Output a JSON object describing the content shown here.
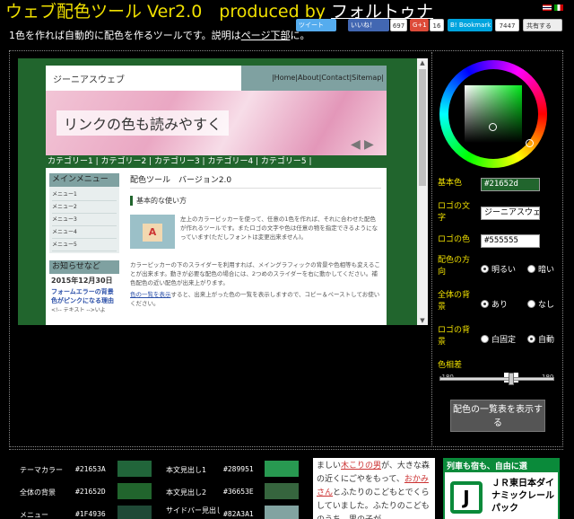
{
  "header": {
    "title": "ウェブ配色ツール Ver2.0　produced by ",
    "author": "フォルトゥナ",
    "subtitle_pre": "1色を作れば自動的に配色を作るツールです。説明は",
    "subtitle_link": "ページ下部",
    "subtitle_post": "に。"
  },
  "social": {
    "tweet": "ツイート",
    "like": "いいね！",
    "like_count": "697",
    "gplus": "G+1",
    "gplus_count": "16",
    "bookmark": "B! Bookmark",
    "bookmark_count": "7447",
    "share": "共有する"
  },
  "preview": {
    "site_name": "ジーニアスウェブ",
    "nav": "|Home|About|Contact|Sitemap|",
    "hero_text": "リンクの色も読みやすく",
    "categories": "カテゴリー1 | カテゴリー2 | カテゴリー3 | カテゴリー4 | カテゴリー5 |",
    "main_menu_title": "メインメニュー",
    "menu_items": [
      "メニュー1",
      "メニュー2",
      "メニュー3",
      "メニュー4",
      "メニュー5"
    ],
    "news_title": "お知らせなど",
    "news_date": "2015年12月30日",
    "news_link": "フォームエラーの背景色がピンクになる理由",
    "news_note": "<!-- テキスト -->いよ",
    "article_title": "配色ツール　バージョン2.0",
    "article_subtitle": "基本的な使い方",
    "article_p1": "左上のカラーピッカーを使って、任意の1色を作れば、それに合わせた配色が作れるツールです。またロゴの文字や色は任意の物を指定できるようになっています(ただしフォントは変更出来ません)。",
    "article_p2": "カラーピッカーの下のスライダーを利用すれば、メイングラフィックの背景や色相等も変えることが出来ます。動きが必要な配色の場合には、2つめのスライダーを右に動かしてください。補色配色の近い配色が出来上がります。",
    "article_p3_link": "色の一覧を表示",
    "article_p3": "すると、出来上がった色の一覧を表示しますので、コピー＆ペーストしてお使いください。"
  },
  "controls": {
    "base_color_label": "基本色",
    "base_color_value": "#21652d",
    "logo_text_label": "ロゴの文字",
    "logo_text_value": "ジーニアスウェブ",
    "logo_color_label": "ロゴの色",
    "logo_color_value": "#555555",
    "direction_label": "配色の方向",
    "direction_options": [
      "明るい",
      "暗い"
    ],
    "bg_label": "全体の背景",
    "bg_options": [
      "あり",
      "なし"
    ],
    "logo_bg_label": "ロゴの背景",
    "logo_bg_options": [
      "白固定",
      "自動"
    ],
    "hue_label": "色相差",
    "hue_min": "-180",
    "hue_max": "180",
    "hue_value": "45",
    "show_button": "配色の一覧表を表示する"
  },
  "color_table": [
    {
      "name": "テーマカラー",
      "hex": "#21653A",
      "color": "#21653a"
    },
    {
      "name": "全体の背景",
      "hex": "#21652D",
      "color": "#21652d"
    },
    {
      "name": "メニュー",
      "hex": "#1F4936",
      "color": "#1f4936"
    },
    {
      "name": "本文見出し1",
      "hex": "#289951",
      "color": "#289951"
    },
    {
      "name": "本文見出し2",
      "hex": "#36653E",
      "color": "#36653e"
    },
    {
      "name": "サイドバー見出し",
      "hex": "#82A3A1",
      "color": "#82a3a1"
    }
  ],
  "story": {
    "t1": "ましい",
    "r1": "木こりの男",
    "t2": "が、大きな森の近くにごやをもって、",
    "r2": "おかみさん",
    "t3": "とふたりのこどもとでくらしていました。ふたりのこどものうち、男の子が"
  },
  "ad": {
    "top": "列車も宿も、自由に選",
    "logo": "J",
    "text": "ＪＲ東日本ダイナミックレールパック"
  }
}
